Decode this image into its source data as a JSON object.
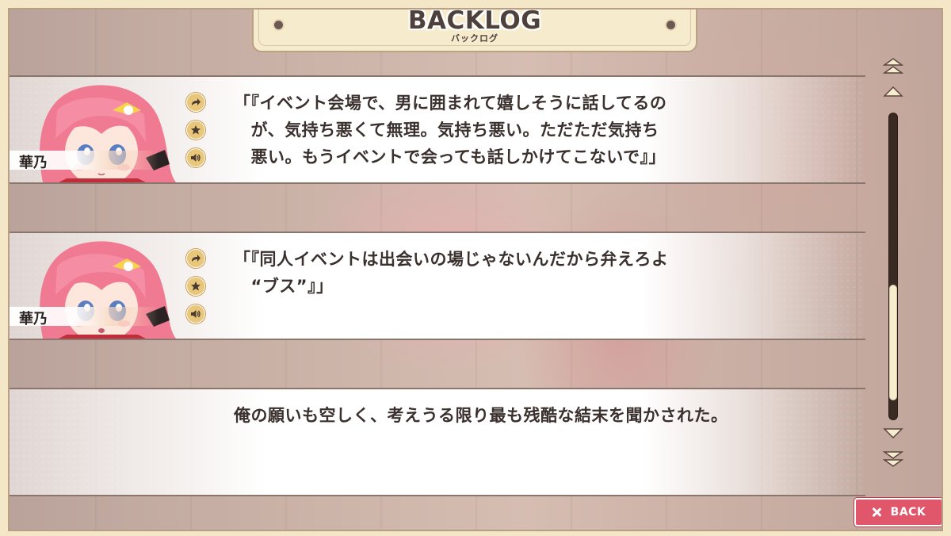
{
  "header": {
    "title": "BACKLOG",
    "subtitle": "バックログ"
  },
  "entries": [
    {
      "speaker": "華乃",
      "text": "「『イベント会場で、男に囲まれて嬉しそうに話してるの\n　が、気持ち悪くて無理。気持ち悪い。ただただ気持ち\n　悪い。もうイベントで会っても話しかけてこないで』」",
      "icons": [
        "jump-icon",
        "favorite-star-icon",
        "voice-replay-icon"
      ]
    },
    {
      "speaker": "華乃",
      "text": "「『同人イベントは出会いの場じゃないんだから弁えろよ\n　“ブス”』」",
      "icons": [
        "jump-icon",
        "favorite-star-icon",
        "voice-replay-icon"
      ]
    },
    {
      "speaker": "",
      "text": "俺の願いも空しく、考えうる限り最も残酷な結末を聞かされた。"
    }
  ],
  "scrollbar": {
    "position_fraction": 0.9
  },
  "back_button": {
    "label": "BACK"
  },
  "colors": {
    "accent": "#e0576b",
    "frame": "#f3e7c7",
    "icon_gold": "#e8c67a",
    "text": "#3a312e"
  }
}
